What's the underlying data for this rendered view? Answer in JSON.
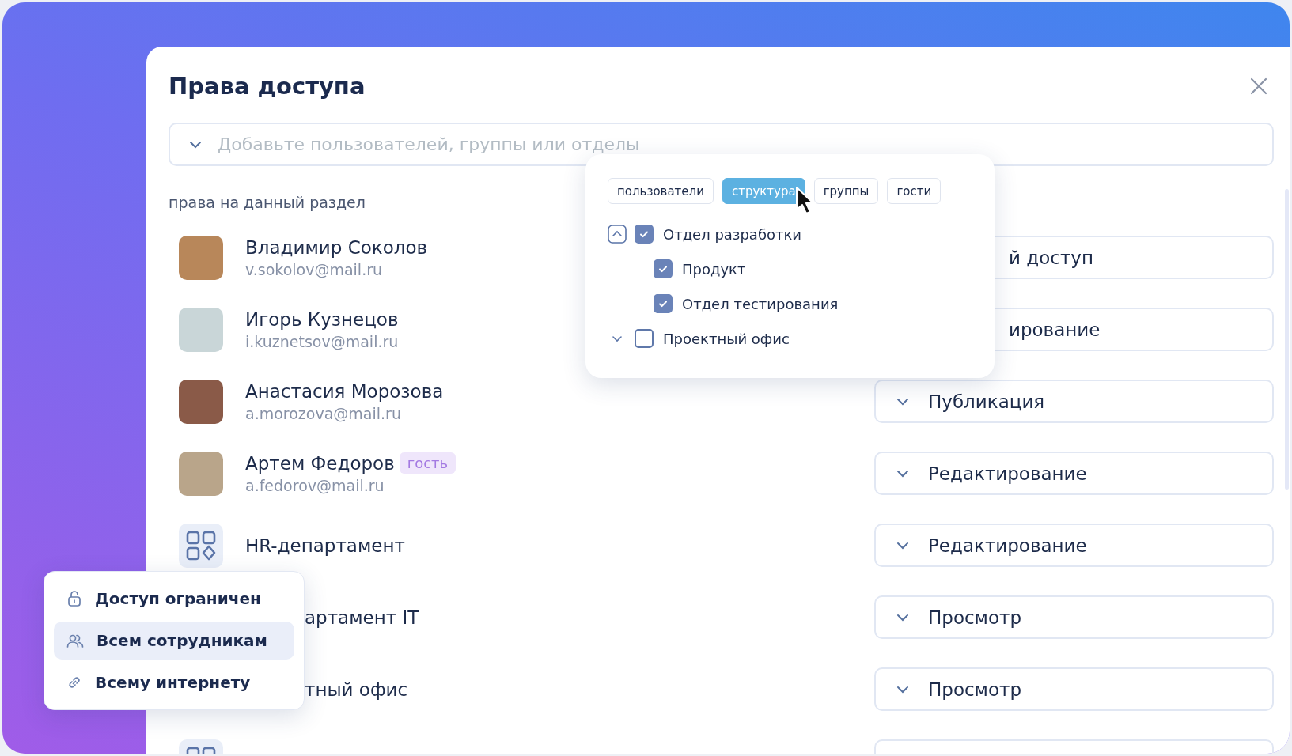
{
  "dialog": {
    "title": "Права доступа"
  },
  "search": {
    "placeholder": "Добавьте пользователей, группы или отделы"
  },
  "section_label": "права на данный раздел",
  "members": [
    {
      "kind": "person",
      "name": "Владимир Соколов",
      "email": "v.sokolov@mail.ru",
      "access": {
        "value": "й доступ",
        "clipped": true
      }
    },
    {
      "kind": "person",
      "name": "Игорь Кузнецов",
      "email": "i.kuznetsov@mail.ru",
      "access": {
        "value": "ирование",
        "clipped": true
      }
    },
    {
      "kind": "person",
      "name": "Анастасия Морозова",
      "email": "a.morozova@mail.ru",
      "access": {
        "value": "Публикация"
      }
    },
    {
      "kind": "person",
      "name": "Артем Федоров",
      "badge": "гость",
      "email": "a.fedorov@mail.ru",
      "access": {
        "value": "Редактирование"
      }
    },
    {
      "kind": "group",
      "name": "HR-департамент",
      "access": {
        "value": "Редактирование"
      }
    },
    {
      "name": "артамент IT",
      "clipped": true,
      "access": {
        "value": "Просмотр"
      }
    },
    {
      "name": "тный офис",
      "clipped": true,
      "access": {
        "value": "Просмотр"
      }
    },
    {
      "kind": "group"
    }
  ],
  "picker": {
    "tabs": [
      {
        "label": "пользователи",
        "selected": false
      },
      {
        "label": "структура",
        "selected": true
      },
      {
        "label": "группы",
        "selected": false
      },
      {
        "label": "гости",
        "selected": false
      }
    ],
    "tree": [
      {
        "label": "Отдел разработки",
        "checked": true,
        "expanded": true,
        "children": [
          {
            "label": "Продукт",
            "checked": true
          },
          {
            "label": "Отдел тестирования",
            "checked": true
          }
        ]
      },
      {
        "label": "Проектный офис",
        "checked": false,
        "expanded": false
      }
    ]
  },
  "visibility_menu": {
    "items": [
      {
        "kind": "lock",
        "label": "Доступ ограничен",
        "selected": false
      },
      {
        "kind": "users",
        "label": "Всем сотрудникам",
        "selected": true
      },
      {
        "kind": "link",
        "label": "Всему интернету",
        "selected": false
      }
    ]
  }
}
